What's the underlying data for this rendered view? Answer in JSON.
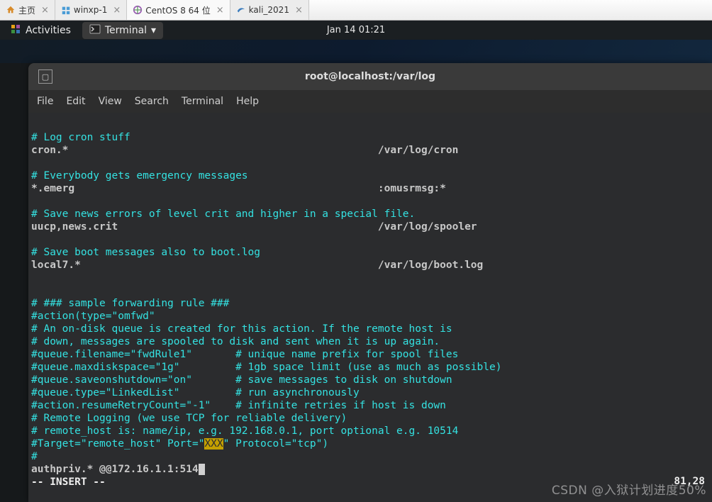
{
  "vm_tabs": [
    {
      "label": "主页",
      "icon": "home-icon"
    },
    {
      "label": "winxp-1",
      "icon": "windows-icon"
    },
    {
      "label": "CentOS 8 64 位",
      "icon": "centos-icon",
      "active": true
    },
    {
      "label": "kali_2021",
      "icon": "kali-icon"
    }
  ],
  "gnome": {
    "activities": "Activities",
    "terminal": "Terminal",
    "clock": "Jan 14  01:21"
  },
  "window": {
    "title": "root@localhost:/var/log",
    "menu": [
      "File",
      "Edit",
      "View",
      "Search",
      "Terminal",
      "Help"
    ]
  },
  "editor": {
    "lines": [
      {
        "style": "blank",
        "text": ""
      },
      {
        "style": "comment",
        "text": "# Log cron stuff"
      },
      {
        "style": "normal",
        "text": "cron.*                                                  /var/log/cron"
      },
      {
        "style": "blank",
        "text": ""
      },
      {
        "style": "comment",
        "text": "# Everybody gets emergency messages"
      },
      {
        "style": "normal",
        "text": "*.emerg                                                 :omusrmsg:*"
      },
      {
        "style": "blank",
        "text": ""
      },
      {
        "style": "comment",
        "text": "# Save news errors of level crit and higher in a special file."
      },
      {
        "style": "normal",
        "text": "uucp,news.crit                                          /var/log/spooler"
      },
      {
        "style": "blank",
        "text": ""
      },
      {
        "style": "comment",
        "text": "# Save boot messages also to boot.log"
      },
      {
        "style": "normal",
        "text": "local7.*                                                /var/log/boot.log"
      },
      {
        "style": "blank",
        "text": ""
      },
      {
        "style": "blank",
        "text": ""
      },
      {
        "style": "comment",
        "text": "# ### sample forwarding rule ###"
      },
      {
        "style": "comment",
        "text": "#action(type=\"omfwd\""
      },
      {
        "style": "comment",
        "text": "# An on-disk queue is created for this action. If the remote host is"
      },
      {
        "style": "comment",
        "text": "# down, messages are spooled to disk and sent when it is up again."
      },
      {
        "style": "comment",
        "text": "#queue.filename=\"fwdRule1\"       # unique name prefix for spool files"
      },
      {
        "style": "comment",
        "text": "#queue.maxdiskspace=\"1g\"         # 1gb space limit (use as much as possible)"
      },
      {
        "style": "comment",
        "text": "#queue.saveonshutdown=\"on\"       # save messages to disk on shutdown"
      },
      {
        "style": "comment",
        "text": "#queue.type=\"LinkedList\"         # run asynchronously"
      },
      {
        "style": "comment",
        "text": "#action.resumeRetryCount=\"-1\"    # infinite retries if host is down"
      },
      {
        "style": "comment",
        "text": "# Remote Logging (we use TCP for reliable delivery)"
      },
      {
        "style": "comment",
        "text": "# remote_host is: name/ip, e.g. 192.168.0.1, port optional e.g. 10514"
      }
    ],
    "target_pre": "#Target=\"remote_host\" Port=\"",
    "target_hl": "XXX",
    "target_post": "\" Protocol=\"tcp\")",
    "hash_line": "#",
    "insert_line": "authpriv.* @@172.16.1.1:514",
    "mode": "-- INSERT --",
    "pos": "81,28"
  },
  "watermark": "CSDN @入狱计划进度50%"
}
